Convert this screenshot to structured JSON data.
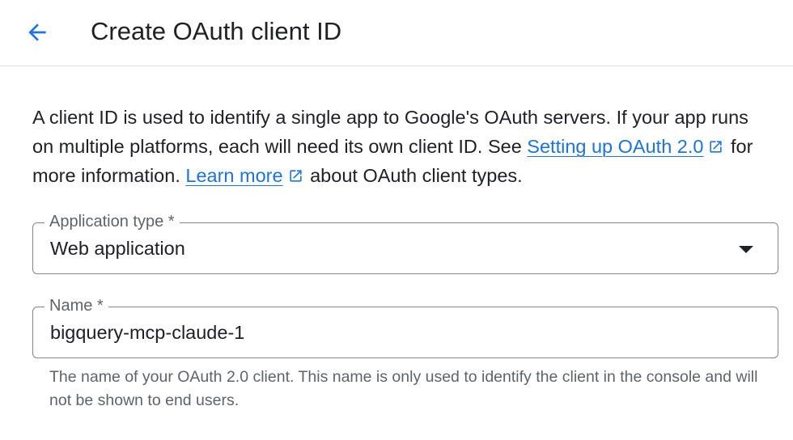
{
  "header": {
    "title": "Create OAuth client ID",
    "back_icon": "arrow-back-icon"
  },
  "intro": {
    "text_1": "A client ID is used to identify a single app to Google's OAuth servers. If your app runs on multiple platforms, each will need its own client ID. See ",
    "link_setup": "Setting up OAuth 2.0",
    "text_2": " for more information. ",
    "link_learn": "Learn more",
    "text_3": " about OAuth client types.",
    "link_color": "#1a73e8",
    "link_icon": "open-in-new-icon"
  },
  "application_type": {
    "label": "Application type *",
    "value": "Web application"
  },
  "name_field": {
    "label": "Name *",
    "value": "bigquery-mcp-claude-1",
    "hint": "The name of your OAuth 2.0 client. This name is only used to identify the client in the console and will not be shown to end users."
  }
}
